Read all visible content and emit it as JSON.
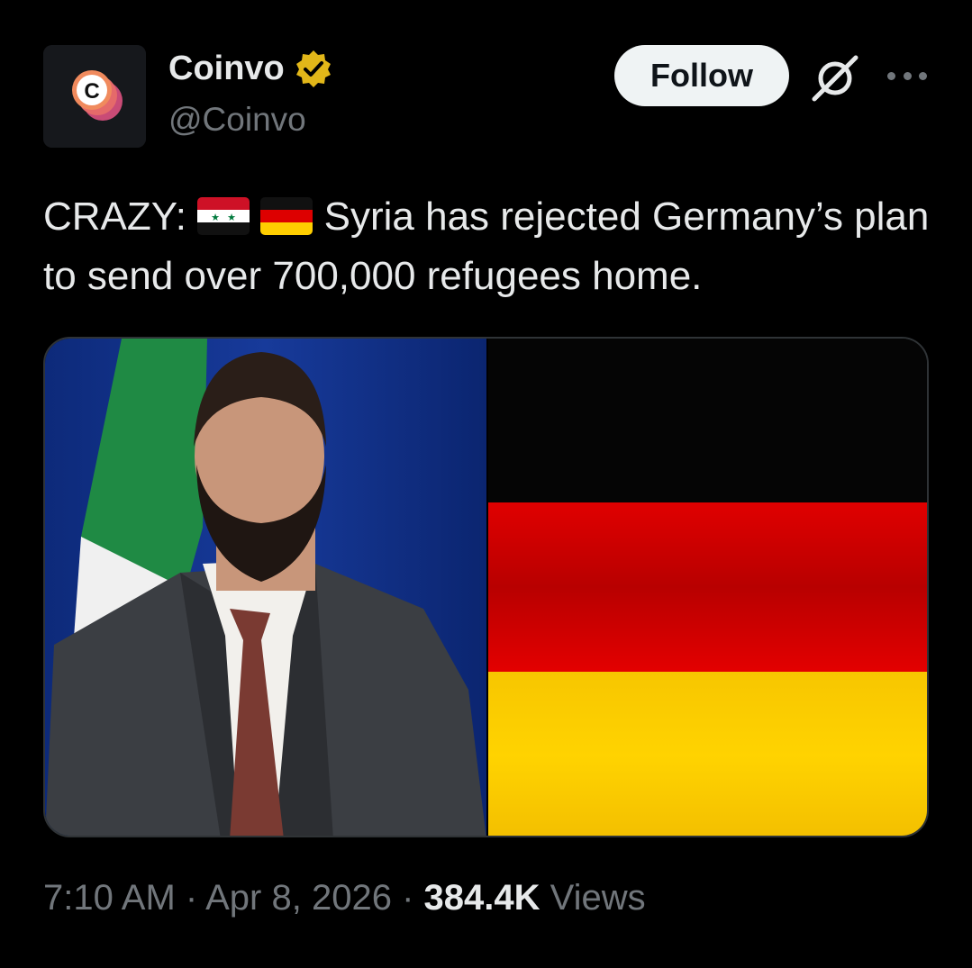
{
  "account": {
    "name": "Coinvo",
    "handle": "@Coinvo",
    "logo_letter": "C",
    "verified": true
  },
  "actions": {
    "follow_label": "Follow",
    "grok_icon": "grok-icon",
    "more_icon": "more-icon"
  },
  "post": {
    "prefix": "CRAZY:",
    "flags": [
      "syria-flag",
      "germany-flag"
    ],
    "body": " Syria has rejected Germany’s plan to send over 700,000 refugees home."
  },
  "meta": {
    "time": "7:10 AM",
    "date": "Apr 8, 2026",
    "views_count": "384.4K",
    "views_label": "Views"
  },
  "colors": {
    "background": "#000000",
    "text": "#e7e9ea",
    "secondary": "#71767b",
    "verified_gold": "#e2b719",
    "logo_orange": "#f08a5d"
  }
}
